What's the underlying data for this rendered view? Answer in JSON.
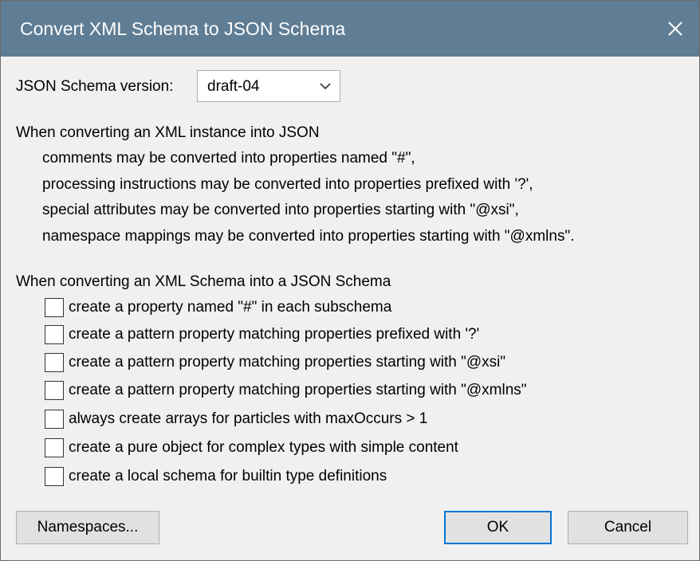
{
  "window": {
    "title": "Convert XML Schema to JSON Schema"
  },
  "version": {
    "label": "JSON Schema version:",
    "selected": "draft-04"
  },
  "instance_section": {
    "heading": "When converting an XML instance into JSON",
    "lines": [
      "comments may be converted into properties named \"#\",",
      "processing instructions may be converted into properties prefixed with '?',",
      "special attributes may be converted into properties starting with \"@xsi\",",
      "namespace mappings may be converted into properties starting with \"@xmlns\"."
    ]
  },
  "schema_section": {
    "heading": "When converting an XML Schema into a JSON Schema",
    "options": [
      {
        "label": "create a property named \"#\" in each subschema",
        "checked": false
      },
      {
        "label": "create a pattern property matching properties prefixed with '?'",
        "checked": false
      },
      {
        "label": "create a pattern property matching properties starting with \"@xsi\"",
        "checked": false
      },
      {
        "label": "create a pattern property matching properties starting with \"@xmlns\"",
        "checked": false
      },
      {
        "label": "always create arrays for particles with maxOccurs > 1",
        "checked": false
      },
      {
        "label": "create a pure object for complex types with simple content",
        "checked": false
      },
      {
        "label": "create a local schema for builtin type definitions",
        "checked": false
      }
    ]
  },
  "buttons": {
    "namespaces": "Namespaces...",
    "ok": "OK",
    "cancel": "Cancel"
  },
  "colors": {
    "titlebar": "#5f7d94",
    "dialog_bg": "#f0f0f0",
    "default_button_border": "#0078d7"
  },
  "icons": {
    "close": "close-icon",
    "dropdown": "chevron-down-icon"
  }
}
